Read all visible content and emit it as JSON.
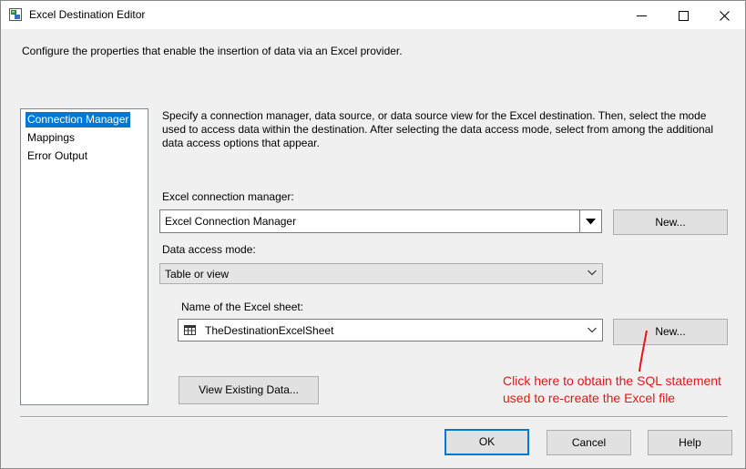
{
  "window": {
    "title": "Excel Destination Editor",
    "minimize_glyph": "—",
    "maximize_glyph": "☐",
    "close_glyph": "✕"
  },
  "description": "Configure the properties that enable the insertion of data via an Excel provider.",
  "nav": {
    "items": [
      {
        "label": "Connection Manager",
        "selected": true
      },
      {
        "label": "Mappings",
        "selected": false
      },
      {
        "label": "Error Output",
        "selected": false
      }
    ]
  },
  "main": {
    "info": "Specify a connection manager, data source, or data source view for the Excel destination. Then, select the mode used to access data within the destination. After selecting the data access mode, select from among the additional data access options that appear.",
    "connection_manager": {
      "label": "Excel connection manager:",
      "value": "Excel Connection Manager",
      "new_button": "New..."
    },
    "access_mode": {
      "label": "Data access mode:",
      "value": "Table or view"
    },
    "sheet": {
      "label": "Name of the Excel sheet:",
      "value": "TheDestinationExcelSheet",
      "new_button": "New..."
    },
    "view_existing_button": "View Existing Data..."
  },
  "annotation": {
    "line1": "Click here to obtain the SQL statement",
    "line2": "used to re-create the Excel file",
    "color": "#e8141b"
  },
  "footer": {
    "ok": "OK",
    "cancel": "Cancel",
    "help": "Help"
  },
  "colors": {
    "selection": "#0078d7",
    "dialog_bg": "#f0f0f0"
  }
}
